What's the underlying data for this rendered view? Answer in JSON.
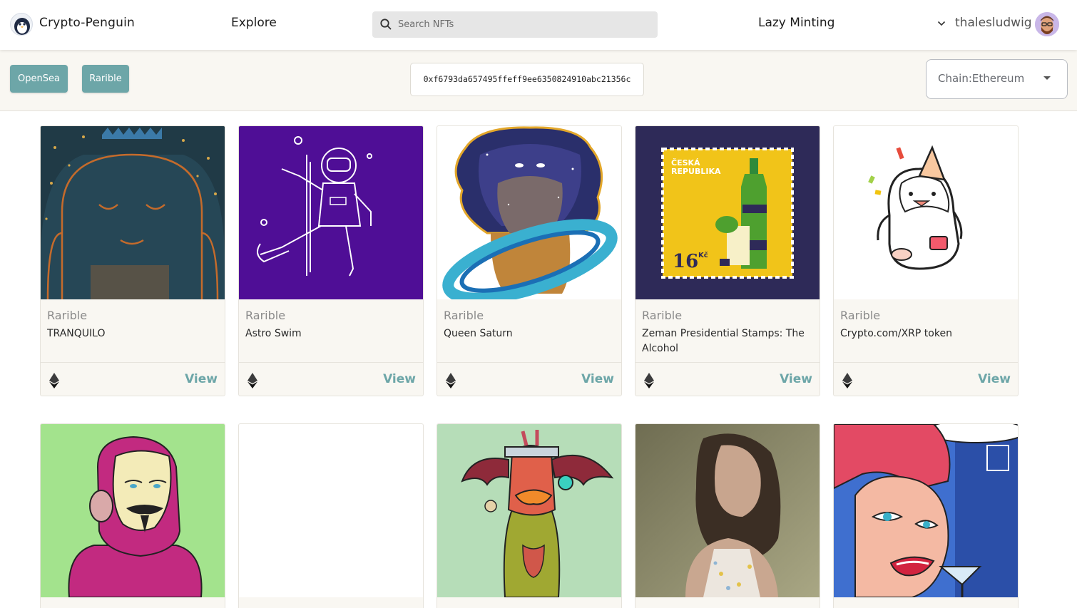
{
  "header": {
    "brand": "Crypto-Penguin",
    "explore": "Explore",
    "search_placeholder": "Search NFTs",
    "lazy_minting": "Lazy Minting",
    "username": "thalesludwig"
  },
  "toolbar": {
    "opensea_label": "OpenSea",
    "rarible_label": "Rarible",
    "address": "0xf6793da657495ffeff9ee6350824910abc21356c",
    "chain_label": "Chain:Ethereum"
  },
  "colors": {
    "accent": "#6da6a8",
    "toolbar_bg": "#f9f7f2",
    "card_bg": "#f9f7f2"
  },
  "cards": [
    {
      "market": "Rarible",
      "name": "TRANQUILO",
      "view": "View",
      "icon": "ethereum-icon"
    },
    {
      "market": "Rarible",
      "name": "Astro Swim",
      "view": "View",
      "icon": "ethereum-icon"
    },
    {
      "market": "Rarible",
      "name": "Queen Saturn",
      "view": "View",
      "icon": "ethereum-icon"
    },
    {
      "market": "Rarible",
      "name": "Zeman Presidential Stamps: The Alcohol",
      "view": "View",
      "icon": "ethereum-icon"
    },
    {
      "market": "Rarible",
      "name": "Crypto.com/XRP token",
      "view": "View",
      "icon": "ethereum-icon"
    }
  ],
  "artwork_text": {
    "stamp_country": "ČESKÁ\nREPUBLIKA",
    "stamp_value": "16",
    "stamp_currency": "Kč"
  }
}
